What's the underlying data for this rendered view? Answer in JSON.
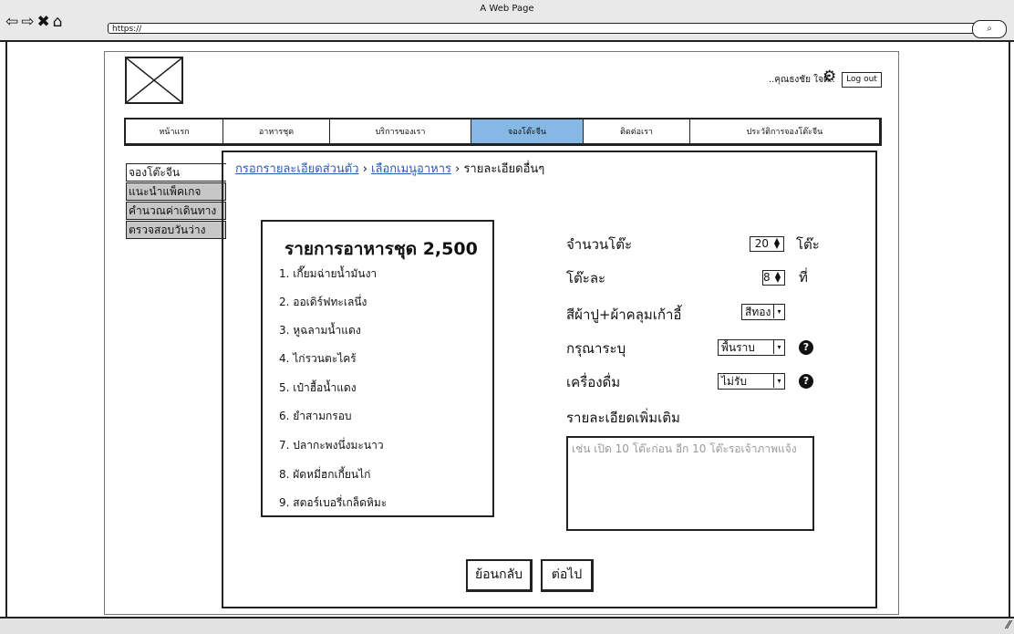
{
  "browser": {
    "window_title": "A Web Page",
    "url": "https://"
  },
  "header": {
    "user_name": "..คุณธงชัย ใจดี..",
    "logout_label": "Log out"
  },
  "nav": {
    "tabs": [
      "หน้าแรก",
      "อาหารชุด",
      "บริการของเรา",
      "จองโต๊ะจีน",
      "ติดต่อเรา",
      "ประวัติการจองโต๊ะจีน"
    ],
    "active_tab": "จองโต๊ะจีน"
  },
  "sidebar": {
    "items": [
      "จองโต๊ะจีน",
      "แนะนำแพ็คเกจ",
      "คำนวณค่าเดินทาง",
      "ตรวจสอบวันว่าง"
    ],
    "active_item": "จองโต๊ะจีน"
  },
  "breadcrumb": {
    "step1": "กรอกรายละเอียดส่วนตัว",
    "sep": " › ",
    "step2": "เลือกเมนูอาหาร",
    "step3": "รายละเอียดอื่นๆ"
  },
  "menu": {
    "title": "รายการอาหารชุด 2,500",
    "items": [
      "1. เกี๊ยมฉ่ายน้ำมันงา",
      "2. ออเดิร์ฟทะเลนึ่ง",
      "3. หูฉลามน้ำแดง",
      "4. ไก่รวนตะไคร้",
      "5. เป๋าฮื้อน้ำแดง",
      "6. ยำสามกรอบ",
      "7. ปลากะพงนึ่งมะนาว",
      "8. ผัดหมี่ฮกเกี้ยนไก่",
      "9. สตอร์เบอรี่เกล็ดหิมะ"
    ]
  },
  "form": {
    "table_count_label": "จำนวนโต๊ะ",
    "table_count_value": "20",
    "table_count_unit": "โต๊ะ",
    "seats_label": "โต๊ะละ",
    "seats_value": "8",
    "seats_unit": "ที่",
    "cloth_color_label": "สีผ้าปู+ผ้าคลุมเก้าอี้",
    "cloth_color_value": "สีทอง",
    "specify_label": "กรุณาระบุ",
    "specify_value": "พื้นราบ",
    "drinks_label": "เครื่องดื่ม",
    "drinks_value": "ไม่รับ",
    "details_label": "รายละเอียดเพิ่มเติม",
    "details_placeholder": "เช่น เปิด 10 โต๊ะก่อน อีก 10 โต๊ะรอเจ้าภาพแจ้ง"
  },
  "buttons": {
    "back": "ย้อนกลับ",
    "next": "ต่อไป"
  },
  "icons": {
    "back": "left-arrow-icon",
    "forward": "right-arrow-icon",
    "close": "close-icon",
    "home": "home-icon",
    "settings": "gear-icon",
    "help": "question-circle-icon",
    "search": "search-icon"
  },
  "colors": {
    "active_tab": "#86b8e6",
    "link": "#2a5db0",
    "sidebar_inactive": "#c7c7c7"
  }
}
